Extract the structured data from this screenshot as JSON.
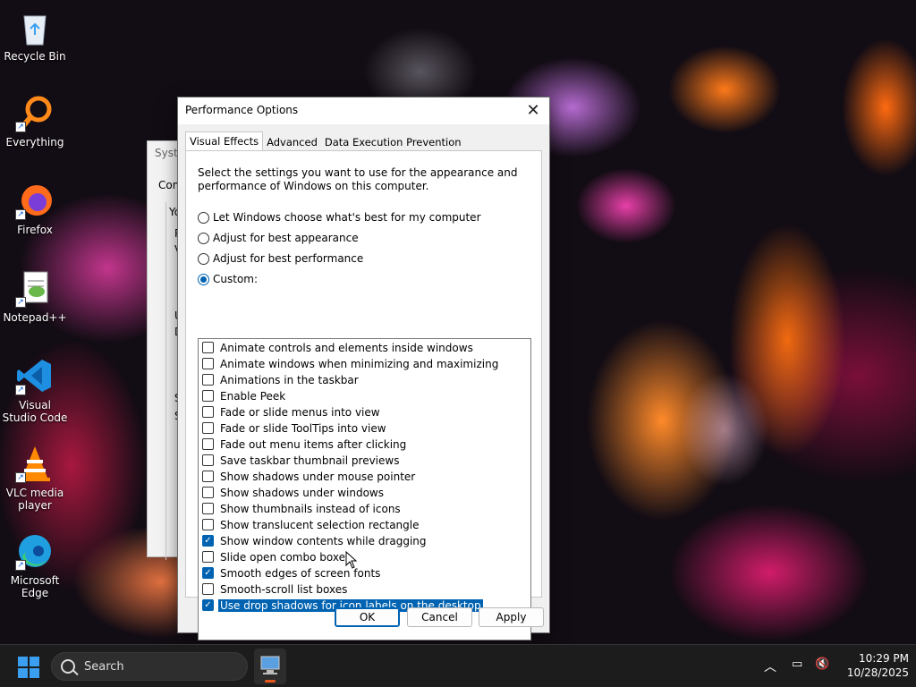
{
  "desktop": {
    "icons": [
      {
        "label": "Recycle Bin",
        "icon": "recycle-bin-icon"
      },
      {
        "label": "Everything",
        "icon": "everything-search-icon"
      },
      {
        "label": "Firefox",
        "icon": "firefox-icon"
      },
      {
        "label": "Notepad++",
        "icon": "notepad-plus-plus-icon"
      },
      {
        "label": "Visual Studio Code",
        "icon": "vscode-icon"
      },
      {
        "label": "VLC media player",
        "icon": "vlc-icon"
      },
      {
        "label": "Microsoft Edge",
        "icon": "edge-icon"
      }
    ]
  },
  "background_window": {
    "title": "Syste",
    "tab": "Com",
    "labels": [
      "Yo",
      "P",
      "V",
      "U",
      "D",
      "S",
      "S"
    ]
  },
  "dialog": {
    "title": "Performance Options",
    "tabs": [
      "Visual Effects",
      "Advanced",
      "Data Execution Prevention"
    ],
    "active_tab": "Visual Effects",
    "description": "Select the settings you want to use for the appearance and performance of Windows on this computer.",
    "radios": [
      {
        "label": "Let Windows choose what's best for my computer",
        "selected": false
      },
      {
        "label": "Adjust for best appearance",
        "selected": false
      },
      {
        "label": "Adjust for best performance",
        "selected": false
      },
      {
        "label": "Custom:",
        "selected": true
      }
    ],
    "options": [
      {
        "label": "Animate controls and elements inside windows",
        "checked": false
      },
      {
        "label": "Animate windows when minimizing and maximizing",
        "checked": false
      },
      {
        "label": "Animations in the taskbar",
        "checked": false
      },
      {
        "label": "Enable Peek",
        "checked": false
      },
      {
        "label": "Fade or slide menus into view",
        "checked": false
      },
      {
        "label": "Fade or slide ToolTips into view",
        "checked": false
      },
      {
        "label": "Fade out menu items after clicking",
        "checked": false
      },
      {
        "label": "Save taskbar thumbnail previews",
        "checked": false
      },
      {
        "label": "Show shadows under mouse pointer",
        "checked": false
      },
      {
        "label": "Show shadows under windows",
        "checked": false
      },
      {
        "label": "Show thumbnails instead of icons",
        "checked": false
      },
      {
        "label": "Show translucent selection rectangle",
        "checked": false
      },
      {
        "label": "Show window contents while dragging",
        "checked": true
      },
      {
        "label": "Slide open combo boxes",
        "checked": false
      },
      {
        "label": "Smooth edges of screen fonts",
        "checked": true
      },
      {
        "label": "Smooth-scroll list boxes",
        "checked": false
      },
      {
        "label": "Use drop shadows for icon labels on the desktop",
        "checked": true,
        "selected": true
      }
    ],
    "buttons": {
      "ok": "OK",
      "cancel": "Cancel",
      "apply": "Apply"
    },
    "accent_color": "#0063b1"
  },
  "taskbar": {
    "search_placeholder": "Search",
    "time": "10:29 PM",
    "date": "10/28/2025",
    "tray_icons": [
      "chevron-up-icon",
      "network-icon",
      "volume-muted-icon"
    ]
  }
}
